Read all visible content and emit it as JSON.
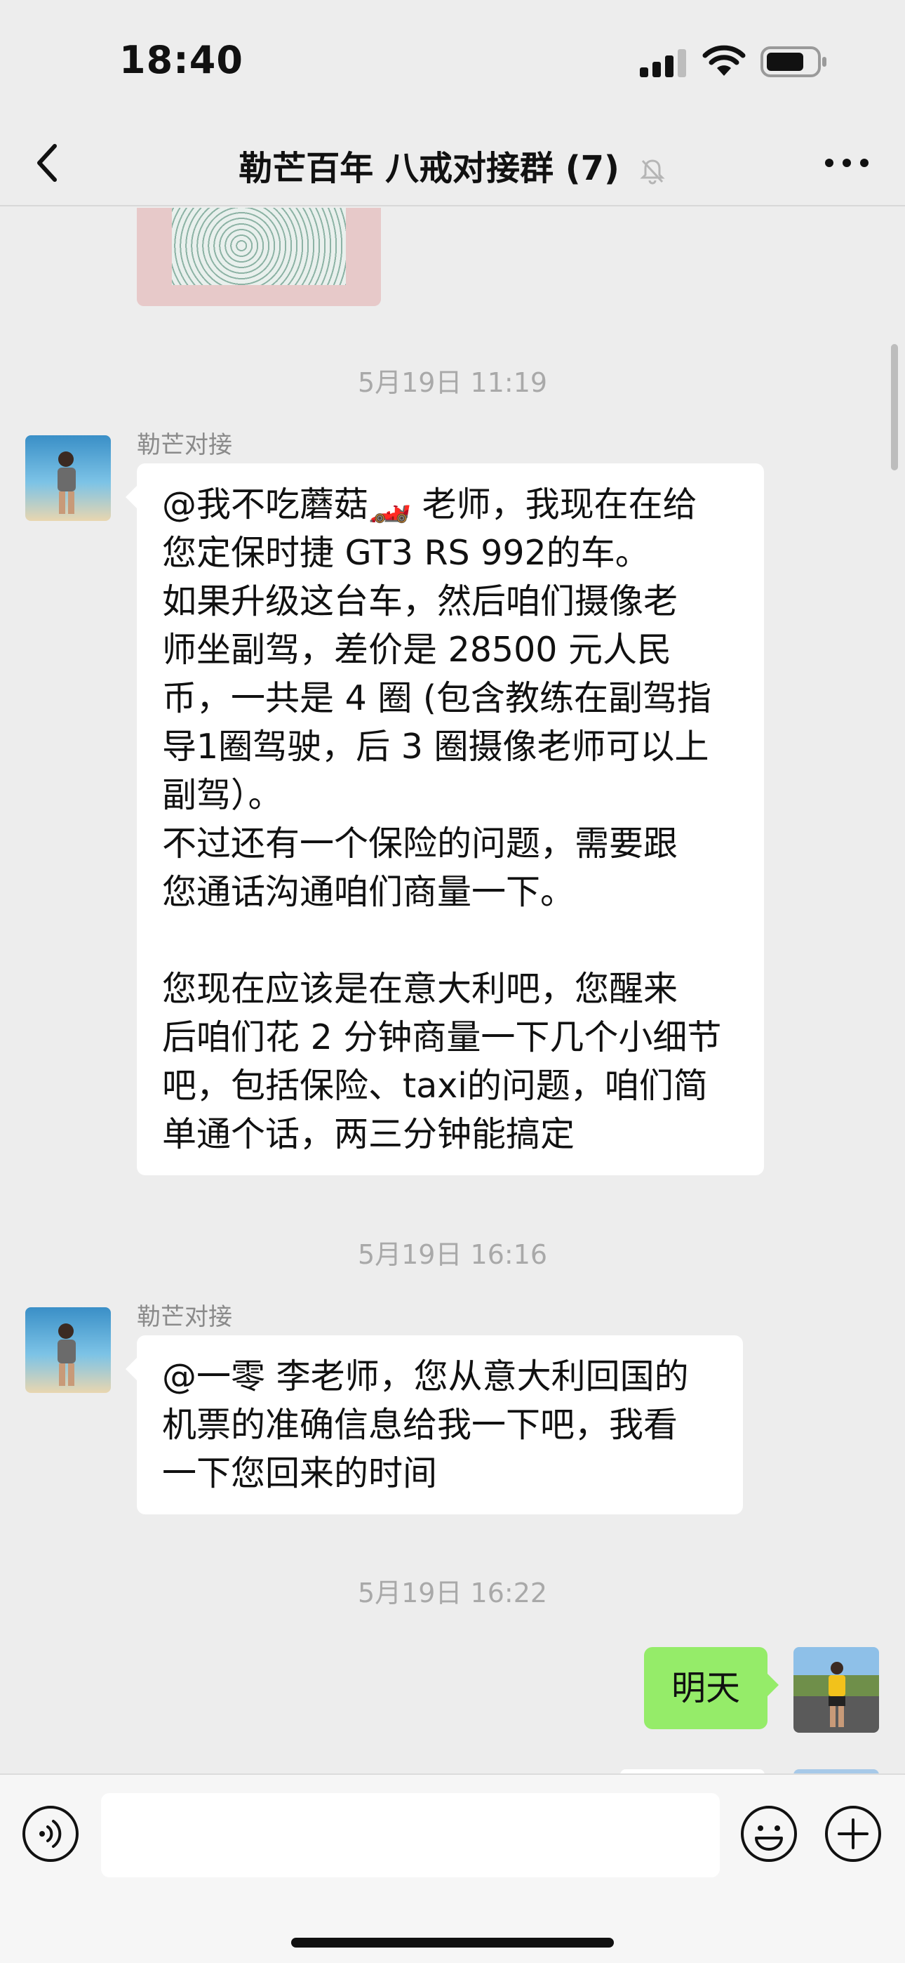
{
  "status_bar": {
    "time": "18:40"
  },
  "header": {
    "title": "勒芒百年 八戒对接群 (7)"
  },
  "messages": [
    {
      "timestamp": "5月19日 11:19",
      "sender": "勒芒对接",
      "text": "@我不吃蘑菇🏎️ 老师，我现在在给\n您定保时捷 GT3 RS 992的车。\n如果升级这台车，然后咱们摄像老\n师坐副驾，差价是 28500 元人民\n币，一共是 4 圈 (包含教练在副驾指\n导1圈驾驶，后 3 圈摄像老师可以上\n副驾）。\n不过还有一个保险的问题，需要跟\n您通话沟通咱们商量一下。\n\n您现在应该是在意大利吧，您醒来\n后咱们花 2 分钟商量一下几个小细节\n吧，包括保险、taxi的问题，咱们简\n单通个话，两三分钟能搞定"
    },
    {
      "timestamp": "5月19日 16:16",
      "sender": "勒芒对接",
      "text": "@一零 李老师，您从意大利回国的\n机票的准确信息给我一下吧，我看\n一下您回来的时间"
    },
    {
      "timestamp": "5月19日 16:22",
      "text": "明天"
    }
  ],
  "icons": {
    "back": "chevron-left-icon",
    "mute": "bell-slash-icon",
    "more": "more-dots-icon",
    "voice": "voice-icon",
    "emoji": "emoji-icon",
    "plus": "plus-icon"
  },
  "colors": {
    "background": "#ededed",
    "own_bubble": "#95ec69",
    "other_bubble": "#ffffff",
    "timestamp": "#a9a9a9"
  }
}
